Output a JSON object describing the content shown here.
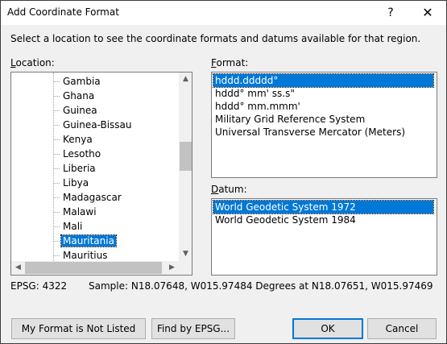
{
  "window": {
    "title": "Add Coordinate Format",
    "help_glyph": "?",
    "close_glyph": "✕"
  },
  "instructions": "Select a location to see the coordinate formats and datums available for that region.",
  "location": {
    "label_mnemonic": "L",
    "label_rest": "ocation:",
    "items": [
      "Gambia",
      "Ghana",
      "Guinea",
      "Guinea-Bissau",
      "Kenya",
      "Lesotho",
      "Liberia",
      "Libya",
      "Madagascar",
      "Malawi",
      "Mali",
      "Mauritania",
      "Mauritius"
    ],
    "selected": "Mauritania"
  },
  "format": {
    "label_mnemonic": "F",
    "label_rest": "ormat:",
    "items": [
      "hddd.ddddd°",
      "hddd° mm' ss.s\"",
      "hddd° mm.mmm'",
      "Military Grid Reference System",
      "Universal Transverse Mercator (Meters)"
    ],
    "selected": "hddd.ddddd°"
  },
  "datum": {
    "label_mnemonic": "D",
    "label_rest": "atum:",
    "items": [
      "World Geodetic System 1972",
      "World Geodetic System 1984"
    ],
    "selected": "World Geodetic System 1972"
  },
  "epsg": "EPSG: 4322",
  "sample": "Sample: N18.07648, W015.97484 Degrees at N18.07651, W015.97469",
  "buttons": {
    "not_listed": "My Format is Not Listed",
    "find_epsg": "Find by EPSG...",
    "ok": "OK",
    "cancel": "Cancel"
  },
  "scroll_glyphs": {
    "up": "▲",
    "down": "▼",
    "left": "◀",
    "right": "▶"
  }
}
